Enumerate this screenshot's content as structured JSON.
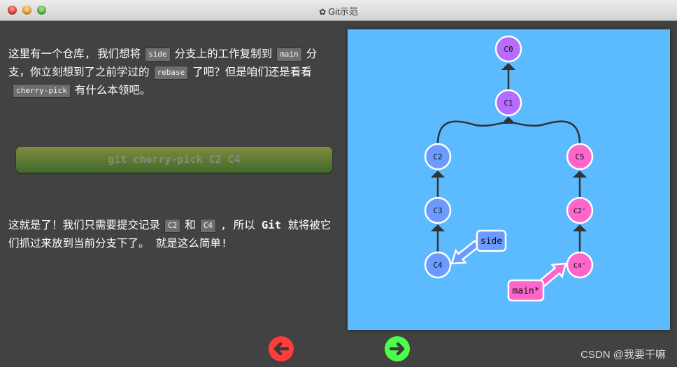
{
  "window": {
    "title": "Git示范",
    "title_icon": "gear-icon"
  },
  "intro": {
    "parts": [
      {
        "text": "这里有一个仓库, 我们想将"
      },
      {
        "code": "side"
      },
      {
        "text": "分支上的工作复制到"
      },
      {
        "code": "main"
      },
      {
        "text": "分支，你立刻想到了之前学过的"
      },
      {
        "code": "rebase"
      },
      {
        "text": "了吧？但是咱们还是看看"
      },
      {
        "code": "cherry-pick"
      },
      {
        "text": "有什么本领吧。"
      }
    ]
  },
  "command": {
    "label": "git cherry-pick C2 C4"
  },
  "outro": {
    "parts": [
      {
        "text": "这就是了！我们只需要提交记录"
      },
      {
        "code": "C2"
      },
      {
        "text": "和"
      },
      {
        "code": "C4"
      },
      {
        "text": ", 所以 "
      },
      {
        "bold": "Git"
      },
      {
        "text": " 就将被它们抓过来放到当前分支下了。 就是这么简单!"
      }
    ]
  },
  "graph": {
    "colors": {
      "background": "#5cbaff",
      "main_commit": "#b56cff",
      "side_commit": "#6b9bff",
      "pink_commit": "#ff66cc",
      "edge": "#333333",
      "stroke": "#ffffff"
    },
    "commits": [
      {
        "id": "C0",
        "color": "main_commit"
      },
      {
        "id": "C1",
        "color": "main_commit"
      },
      {
        "id": "C2",
        "color": "side_commit"
      },
      {
        "id": "C3",
        "color": "side_commit"
      },
      {
        "id": "C4",
        "color": "side_commit"
      },
      {
        "id": "C5",
        "color": "pink_commit"
      },
      {
        "id": "C2'",
        "color": "pink_commit"
      },
      {
        "id": "C4'",
        "color": "pink_commit"
      }
    ],
    "edges": [
      {
        "from": "C1",
        "to": "C0"
      },
      {
        "from": "C2",
        "to": "C1"
      },
      {
        "from": "C5",
        "to": "C1"
      },
      {
        "from": "C3",
        "to": "C2"
      },
      {
        "from": "C4",
        "to": "C3"
      },
      {
        "from": "C2'",
        "to": "C5"
      },
      {
        "from": "C4'",
        "to": "C2'"
      }
    ],
    "branches": [
      {
        "name": "side",
        "target": "C4",
        "color": "side_commit"
      },
      {
        "name": "main*",
        "target": "C4'",
        "color": "pink_commit"
      }
    ]
  },
  "nav": {
    "prev_color": "#ff3b3b",
    "next_color": "#4cff4c"
  },
  "watermark": "CSDN @我要干嘛"
}
